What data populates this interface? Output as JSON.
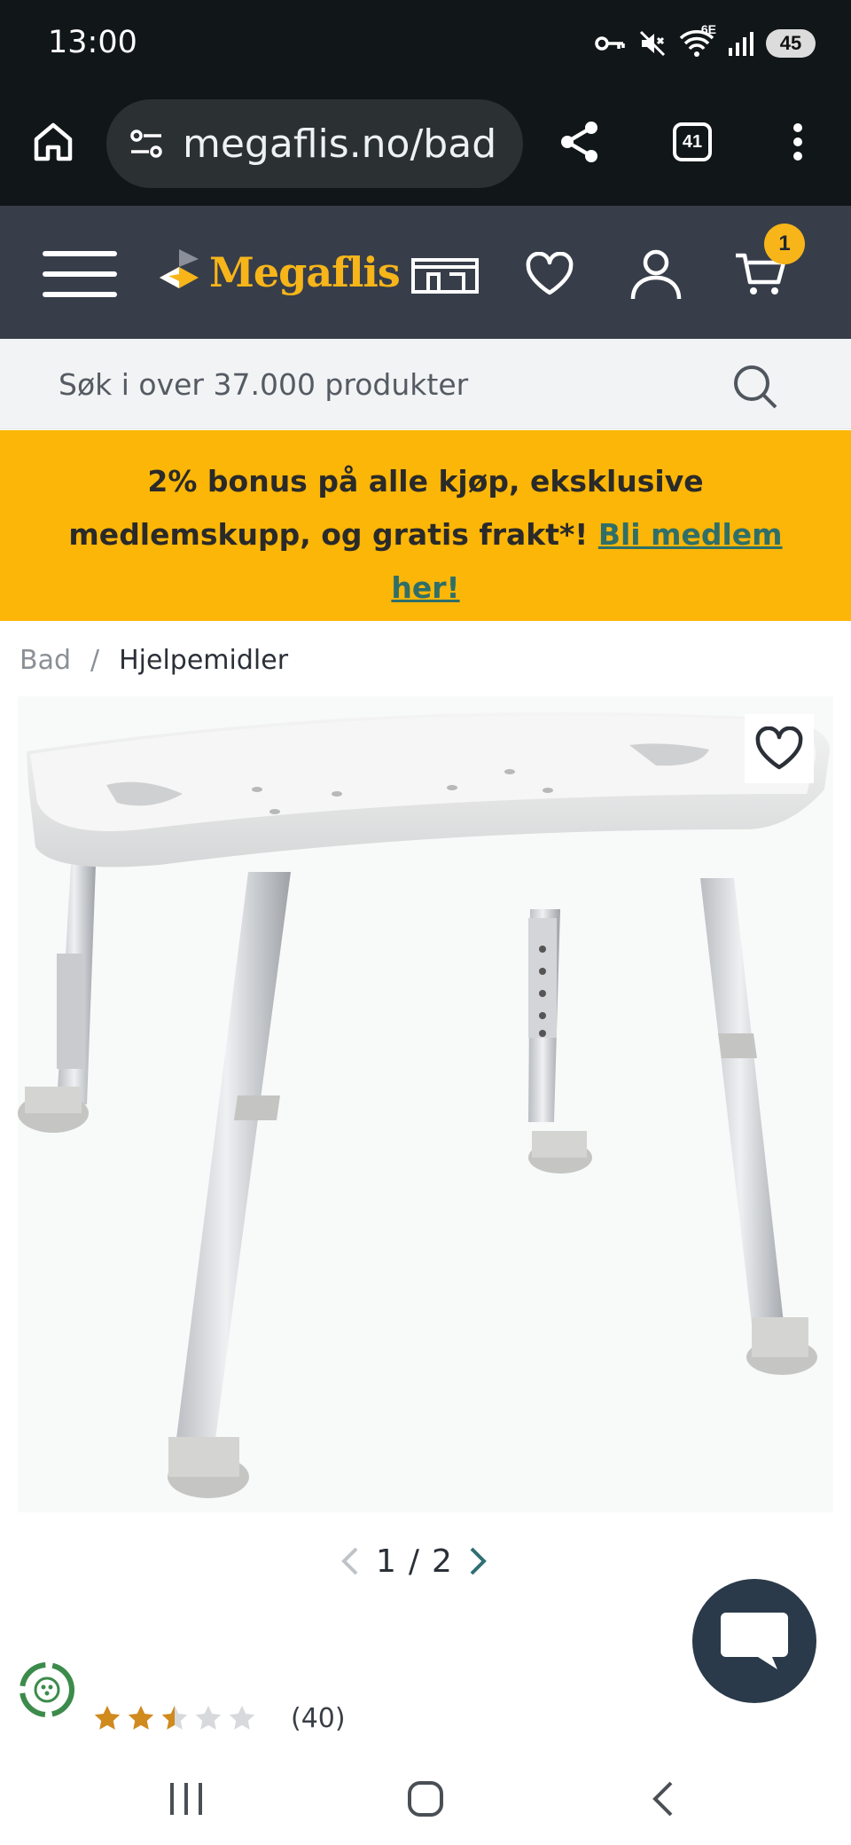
{
  "status_bar": {
    "time": "13:00",
    "network": "6E",
    "battery": "45"
  },
  "browser": {
    "url": "megaflis.no/bad",
    "tab_count": "41"
  },
  "header": {
    "logo_text": "Megaflis",
    "cart_count": "1"
  },
  "search": {
    "placeholder": "Søk i over 37.000 produkter"
  },
  "promo": {
    "text": "2% bonus på alle kjøp, eksklusive medlemskupp, og gratis frakt*! ",
    "link_text": "Bli medlem her!"
  },
  "breadcrumb": {
    "items": [
      "Bad",
      "Hjelpemidler"
    ],
    "separator": "/"
  },
  "gallery": {
    "current": "1",
    "separator": "/",
    "total": "2"
  },
  "rating": {
    "value": 2.5,
    "max": 5,
    "count_label": "(40)"
  },
  "colors": {
    "header_bg": "#373e4a",
    "brand_yellow": "#f7b51a",
    "promo_bg": "#fcb607",
    "link_teal": "#2f6f68",
    "star": "#d08a1e",
    "chat_bg": "#2a3a4a"
  },
  "icons": {
    "home": "home-icon",
    "site_info": "site-settings-icon",
    "share": "share-icon",
    "tabs": "tabs-icon",
    "menu": "more-vert-icon",
    "hamburger": "hamburger-icon",
    "store": "store-icon",
    "wishlist": "heart-icon",
    "account": "user-icon",
    "cart": "cart-icon",
    "search": "search-icon",
    "chat": "chat-icon",
    "eco": "eco-badge-icon"
  }
}
